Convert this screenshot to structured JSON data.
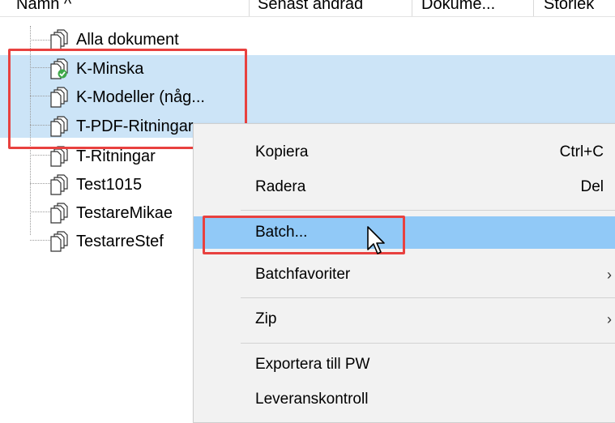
{
  "header": {
    "columns": [
      {
        "label": "Namn  ^"
      },
      {
        "label": "Senast ändrad"
      },
      {
        "label": "Dokume..."
      },
      {
        "label": "Storlek"
      }
    ]
  },
  "tree": {
    "items": [
      {
        "label": "Alla dokument",
        "icon": "document-stack-icon",
        "selected": false
      },
      {
        "label": "K-Minska",
        "icon": "document-stack-checked-icon",
        "selected": true
      },
      {
        "label": "K-Modeller (någ...",
        "icon": "document-stack-icon",
        "selected": true
      },
      {
        "label": "T-PDF-Ritningar",
        "icon": "document-stack-icon",
        "selected": true
      },
      {
        "label": "T-Ritningar",
        "icon": "document-stack-icon",
        "selected": false
      },
      {
        "label": "Test1015",
        "icon": "document-stack-icon",
        "selected": false
      },
      {
        "label": "TestareMikae",
        "icon": "document-stack-icon",
        "selected": false
      },
      {
        "label": "TestarreStef",
        "icon": "document-stack-icon",
        "selected": false
      }
    ]
  },
  "context_menu": {
    "items": [
      {
        "label": "Kopiera",
        "shortcut": "Ctrl+C"
      },
      {
        "label": "Radera",
        "shortcut": "Del"
      },
      {
        "label": "Batch...",
        "shortcut": "",
        "highlighted": true
      },
      {
        "label": "Batchfavoriter",
        "submenu_arrow": "›"
      },
      {
        "label": "Zip",
        "submenu_arrow": "›"
      },
      {
        "label": "Exportera till PW",
        "shortcut": ""
      },
      {
        "label": "Leveranskontroll",
        "shortcut": ""
      }
    ]
  },
  "colors": {
    "selection": "#cce4f7",
    "menu_highlight": "#91c9f7",
    "annotation_red": "#e8413f",
    "menu_bg": "#f2f2f2"
  }
}
